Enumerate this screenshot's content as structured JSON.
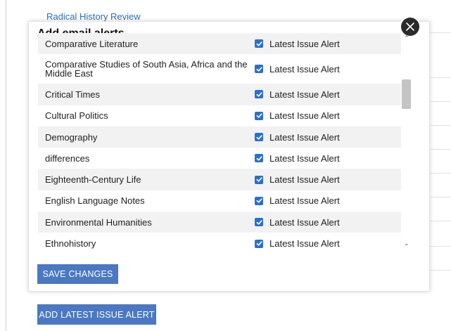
{
  "background": {
    "partial_link": "Radical History Review",
    "add_button_label": "ADD LATEST ISSUE ALERT"
  },
  "modal": {
    "title": "Add email alerts",
    "close_icon": "close-icon",
    "save_button_label": "SAVE CHANGES",
    "items": [
      {
        "name": "Comparative Literature",
        "alert_label": "Latest Issue Alert",
        "checked": true
      },
      {
        "name": "Comparative Studies of South Asia, Africa and the Middle East",
        "alert_label": "Latest Issue Alert",
        "checked": true
      },
      {
        "name": "Critical Times",
        "alert_label": "Latest Issue Alert",
        "checked": true
      },
      {
        "name": "Cultural Politics",
        "alert_label": "Latest Issue Alert",
        "checked": true
      },
      {
        "name": "Demography",
        "alert_label": "Latest Issue Alert",
        "checked": true
      },
      {
        "name": "differences",
        "alert_label": "Latest Issue Alert",
        "checked": true
      },
      {
        "name": "Eighteenth-Century Life",
        "alert_label": "Latest Issue Alert",
        "checked": true
      },
      {
        "name": "English Language Notes",
        "alert_label": "Latest Issue Alert",
        "checked": true
      },
      {
        "name": "Environmental Humanities",
        "alert_label": "Latest Issue Alert",
        "checked": true
      },
      {
        "name": "Ethnohistory",
        "alert_label": "Latest Issue Alert",
        "checked": true
      }
    ]
  },
  "colors": {
    "button": "#4a78c2",
    "checkbox": "#2b6fcf",
    "link": "#2a6ebb",
    "row_alt": "#f2f2f2"
  }
}
